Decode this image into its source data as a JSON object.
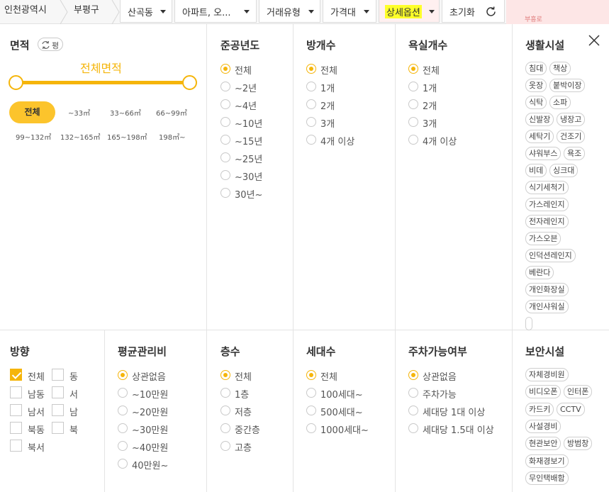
{
  "breadcrumb": [
    "인천광역시",
    "부평구"
  ],
  "filters": {
    "dong": "산곡동",
    "building_type": "아파트, 오...",
    "deal_type": "거래유형",
    "price": "가격대",
    "detail": "상세옵션",
    "reset": "초기화"
  },
  "right_hint": "부흥로",
  "area": {
    "title": "면적",
    "unit_toggle": "평",
    "range_label": "전체면적",
    "range_min": 0,
    "range_max": 1,
    "options": [
      "전체",
      "~33㎡",
      "33~66㎡",
      "66~99㎡",
      "99~132㎡",
      "132~165㎡",
      "165~198㎡",
      "198㎡~"
    ],
    "selected": "전체"
  },
  "built_year": {
    "title": "준공년도",
    "options": [
      "전체",
      "~2년",
      "~4년",
      "~10년",
      "~15년",
      "~25년",
      "~30년",
      "30년~"
    ],
    "selected": "전체"
  },
  "rooms": {
    "title": "방개수",
    "options": [
      "전체",
      "1개",
      "2개",
      "3개",
      "4개 이상"
    ],
    "selected": "전체"
  },
  "bathrooms": {
    "title": "욕실개수",
    "options": [
      "전체",
      "1개",
      "2개",
      "3개",
      "4개 이상"
    ],
    "selected": "전체"
  },
  "living": {
    "title": "생활시설",
    "tags": [
      "침대",
      "책상",
      "옷장",
      "붙박이장",
      "식탁",
      "소파",
      "신발장",
      "냉장고",
      "세탁기",
      "건조기",
      "샤워부스",
      "욕조",
      "비데",
      "싱크대",
      "식기세척기",
      "가스레인지",
      "전자레인지",
      "가스오븐",
      "인덕션레인지",
      "베란다",
      "개인화장실",
      "개인샤워실"
    ]
  },
  "direction": {
    "title": "방향",
    "options": [
      "전체",
      "동",
      "남동",
      "서",
      "남서",
      "남",
      "북동",
      "북",
      "북서"
    ],
    "selected": [
      "전체"
    ]
  },
  "fee": {
    "title": "평균관리비",
    "options": [
      "상관없음",
      "~10만원",
      "~20만원",
      "~30만원",
      "~40만원",
      "40만원~"
    ],
    "selected": "상관없음"
  },
  "floors": {
    "title": "층수",
    "options": [
      "전체",
      "1층",
      "저층",
      "중간층",
      "고층"
    ],
    "selected": "전체"
  },
  "households": {
    "title": "세대수",
    "options": [
      "전체",
      "100세대~",
      "500세대~",
      "1000세대~"
    ],
    "selected": "전체"
  },
  "parking": {
    "title": "주차가능여부",
    "options": [
      "상관없음",
      "주차가능",
      "세대당 1대 이상",
      "세대당 1.5대 이상"
    ],
    "selected": "상관없음"
  },
  "security": {
    "title": "보안시설",
    "tags": [
      "자체경비원",
      "비디오폰",
      "인터폰",
      "카드키",
      "CCTV",
      "사설경비",
      "현관보안",
      "방범창",
      "화재경보기",
      "무인택배함"
    ]
  },
  "colors": {
    "accent": "#f5b50a",
    "highlight": "#ffff2a"
  }
}
